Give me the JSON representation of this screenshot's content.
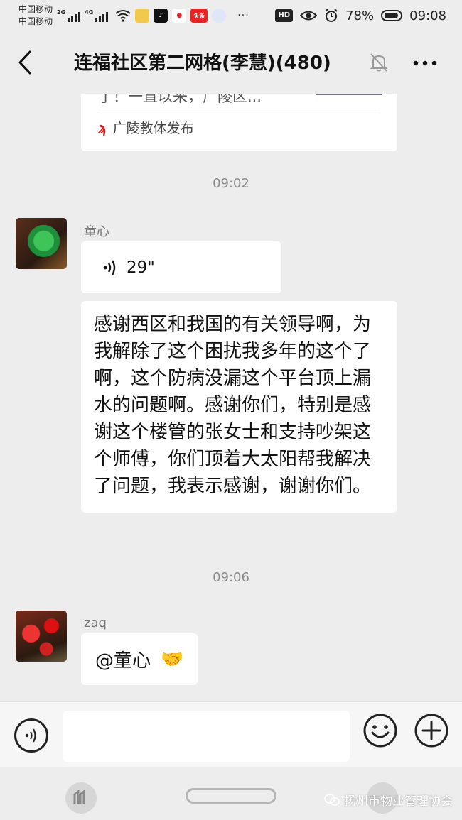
{
  "status_bar": {
    "carrier1": "中国移动",
    "carrier2": "中国移动",
    "net1": "2G",
    "net2": "4G",
    "app_icons": [
      "app-icon",
      "tiktok-icon",
      "map-pin-icon",
      "toutiao-icon",
      "circle-app-icon"
    ],
    "toutiao_label": "头条",
    "more_dots": "···",
    "hd": "HD",
    "battery": "78%",
    "time": "09:08"
  },
  "header": {
    "title": "连福社区第二网格(李慧)(480)"
  },
  "messages": {
    "link_card": {
      "text": "了！一直以来，广陵区...",
      "source": "广陵教体发布"
    },
    "time1": "09:02",
    "msg1": {
      "nickname": "童心",
      "voice_duration": "29\""
    },
    "msg2": {
      "text": "感谢西区和我国的有关领导啊，为我解除了这个困扰我多年的这个了啊，这个防病没漏这个平台顶上漏水的问题啊。感谢你们，特别是感谢这个楼管的张女士和支持吵架这个师傅，你们顶着大太阳帮我解决了问题，我表示感谢，谢谢你们。"
    },
    "time2": "09:06",
    "msg3": {
      "nickname": "zaq",
      "text": "@童心",
      "emoji": "🤝"
    }
  },
  "watermark": "扬州市物业管理协会",
  "colors": {
    "background": "#ededed",
    "bubble": "#ffffff",
    "timestamp": "#8a8a8a"
  }
}
